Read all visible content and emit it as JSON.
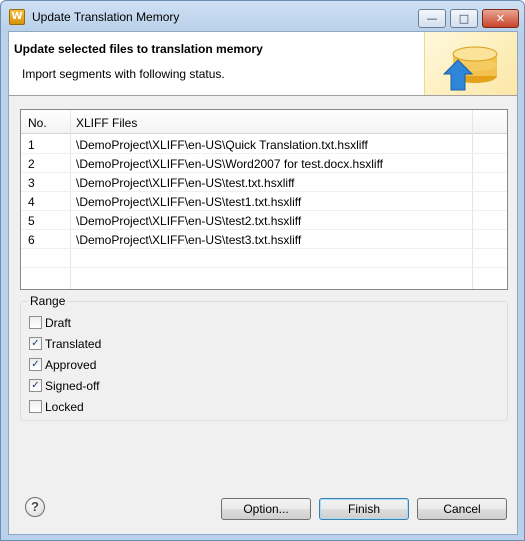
{
  "window": {
    "title": "Update Translation Memory",
    "app_icon_glyph": "W",
    "minimize_glyph": "—",
    "maximize_glyph": "□",
    "close_glyph": "✕"
  },
  "header": {
    "title": "Update selected files to translation memory",
    "subtitle": "Import segments with following status."
  },
  "table": {
    "columns": [
      "No.",
      "XLIFF Files"
    ],
    "rows": [
      {
        "no": "1",
        "file": "\\DemoProject\\XLIFF\\en-US\\Quick Translation.txt.hsxliff"
      },
      {
        "no": "2",
        "file": "\\DemoProject\\XLIFF\\en-US\\Word2007 for test.docx.hsxliff"
      },
      {
        "no": "3",
        "file": "\\DemoProject\\XLIFF\\en-US\\test.txt.hsxliff"
      },
      {
        "no": "4",
        "file": "\\DemoProject\\XLIFF\\en-US\\test1.txt.hsxliff"
      },
      {
        "no": "5",
        "file": "\\DemoProject\\XLIFF\\en-US\\test2.txt.hsxliff"
      },
      {
        "no": "6",
        "file": "\\DemoProject\\XLIFF\\en-US\\test3.txt.hsxliff"
      }
    ]
  },
  "range": {
    "label": "Range",
    "options": [
      {
        "label": "Draft",
        "checked": false
      },
      {
        "label": "Translated",
        "checked": true
      },
      {
        "label": "Approved",
        "checked": true
      },
      {
        "label": "Signed-off",
        "checked": true
      },
      {
        "label": "Locked",
        "checked": false
      }
    ]
  },
  "footer": {
    "help_glyph": "?",
    "option_label": "Option...",
    "finish_label": "Finish",
    "cancel_label": "Cancel"
  },
  "colors": {
    "title_bar": "#b9d1ea",
    "dialog_bg": "#f0f0f0",
    "default_button_border": "#3c7fb1"
  }
}
